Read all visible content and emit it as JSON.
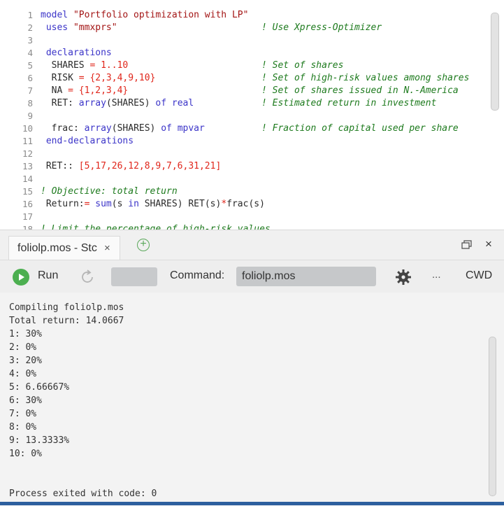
{
  "editor": {
    "lines": [
      {
        "n": "1",
        "parts": [
          {
            "t": "model ",
            "c": "kw"
          },
          {
            "t": "\"Portfolio optimization with LP\"",
            "c": "st"
          }
        ]
      },
      {
        "n": "2",
        "parts": [
          {
            "t": " uses ",
            "c": "kw"
          },
          {
            "t": "\"mmxprs\"",
            "c": "st"
          }
        ],
        "comment": "! Use Xpress-Optimizer"
      },
      {
        "n": "3",
        "parts": []
      },
      {
        "n": "4",
        "parts": [
          {
            "t": " declarations",
            "c": "kw"
          }
        ]
      },
      {
        "n": "5",
        "parts": [
          {
            "t": "  SHARES ",
            "c": ""
          },
          {
            "t": "= 1..10",
            "c": "nm"
          }
        ],
        "comment": "! Set of shares"
      },
      {
        "n": "6",
        "parts": [
          {
            "t": "  RISK ",
            "c": ""
          },
          {
            "t": "= {",
            "c": "op"
          },
          {
            "t": "2,3,4,9,10",
            "c": "nm"
          },
          {
            "t": "}",
            "c": "op"
          }
        ],
        "comment": "! Set of high-risk values among shares"
      },
      {
        "n": "7",
        "parts": [
          {
            "t": "  NA ",
            "c": ""
          },
          {
            "t": "= {",
            "c": "op"
          },
          {
            "t": "1,2,3,4",
            "c": "nm"
          },
          {
            "t": "}",
            "c": "op"
          }
        ],
        "comment": "! Set of shares issued in N.-America"
      },
      {
        "n": "8",
        "parts": [
          {
            "t": "  RET: ",
            "c": ""
          },
          {
            "t": "array",
            "c": "kw"
          },
          {
            "t": "(SHARES) ",
            "c": ""
          },
          {
            "t": "of real",
            "c": "kw"
          }
        ],
        "comment": "! Estimated return in investment"
      },
      {
        "n": "9",
        "parts": []
      },
      {
        "n": "10",
        "parts": [
          {
            "t": "  frac: ",
            "c": ""
          },
          {
            "t": "array",
            "c": "kw"
          },
          {
            "t": "(SHARES) ",
            "c": ""
          },
          {
            "t": "of mpvar",
            "c": "kw"
          }
        ],
        "comment": "! Fraction of capital used per share"
      },
      {
        "n": "11",
        "parts": [
          {
            "t": " end-declarations",
            "c": "kw"
          }
        ]
      },
      {
        "n": "12",
        "parts": []
      },
      {
        "n": "13",
        "parts": [
          {
            "t": " RET:: ",
            "c": ""
          },
          {
            "t": "[",
            "c": "op"
          },
          {
            "t": "5,17,26,12,8,9,7,6,31,21",
            "c": "nm"
          },
          {
            "t": "]",
            "c": "op"
          }
        ]
      },
      {
        "n": "14",
        "parts": []
      },
      {
        "n": "15",
        "parts": [
          {
            "t": "! Objective: total return",
            "c": "cm"
          }
        ]
      },
      {
        "n": "16",
        "parts": [
          {
            "t": " Return:",
            "c": ""
          },
          {
            "t": "= ",
            "c": "op"
          },
          {
            "t": "sum",
            "c": "kw"
          },
          {
            "t": "(s ",
            "c": ""
          },
          {
            "t": "in",
            "c": "kw"
          },
          {
            "t": " SHARES) RET(s)",
            "c": ""
          },
          {
            "t": "*",
            "c": "op"
          },
          {
            "t": "frac(s)",
            "c": ""
          }
        ]
      },
      {
        "n": "17",
        "parts": []
      },
      {
        "n": "18",
        "parts": [
          {
            "t": "! Limit the percentage of high-risk values",
            "c": "cm"
          }
        ]
      }
    ]
  },
  "panel": {
    "tab_label": "foliolp.mos - Stc",
    "tab_close": "×",
    "add_tab": "+",
    "close": "×",
    "run_label": "Run",
    "command_label": "Command:",
    "command_value": "foliolp.mos",
    "more_label": "...",
    "cwd_label": "CWD"
  },
  "output": {
    "lines": [
      "Compiling foliolp.mos",
      "Total return: 14.0667",
      "1: 30%",
      "2: 0%",
      "3: 20%",
      "4: 0%",
      "5: 6.66667%",
      "6: 30%",
      "7: 0%",
      "8: 0%",
      "9: 13.3333%",
      "10: 0%"
    ],
    "exit_line": "Process exited with code: 0"
  },
  "icons": {
    "run": "play-circle-icon",
    "restart": "restart-icon",
    "settings": "gear-icon",
    "add": "plus-circle-icon",
    "maximize": "maximize-icon",
    "close": "close-icon"
  },
  "colors": {
    "keyword": "#3b34c8",
    "string": "#a31515",
    "number": "#e0261b",
    "comment": "#1d7a1d",
    "run": "#4caf50",
    "accent_bar": "#2c5f9e"
  }
}
